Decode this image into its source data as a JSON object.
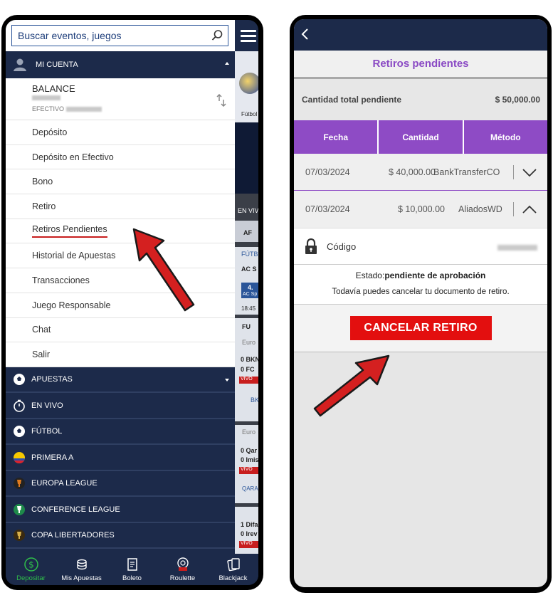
{
  "left": {
    "search": {
      "placeholder": "Buscar eventos, juegos"
    },
    "account_header": "MI CUENTA",
    "balance": {
      "label": "BALANCE",
      "cash_label": "EFECTIVO"
    },
    "menu_items": [
      "Depósito",
      "Depósito en Efectivo",
      "Bono",
      "Retiro",
      "Retiros Pendientes",
      "Historial de Apuestas",
      "Transacciones",
      "Juego Responsable",
      "Chat",
      "Salir"
    ],
    "nav_items": [
      {
        "label": "APUESTAS",
        "icon": "soccer-ball-icon"
      },
      {
        "label": "EN VIVO",
        "icon": "stopwatch-icon"
      },
      {
        "label": "FÚTBOL",
        "icon": "soccer-ball-icon"
      },
      {
        "label": "PRIMERA A",
        "icon": "colombia-flag-icon"
      },
      {
        "label": "EUROPA LEAGUE",
        "icon": "europa-league-icon"
      },
      {
        "label": "CONFERENCE LEAGUE",
        "icon": "conference-league-icon"
      },
      {
        "label": "COPA LIBERTADORES",
        "icon": "libertadores-icon"
      }
    ],
    "strip": {
      "t1": "Fútbol",
      "t2": "EN VIV",
      "t3": "AF",
      "t4": "FÚTB",
      "t5": "AC S",
      "t6": "4.",
      "t7": "AC Sp",
      "t8": "18:45",
      "t9": "FU",
      "t10": "Euro",
      "t11": "0 BKN",
      "t12": "0 FC",
      "t13": "VIVO",
      "t14": "BK",
      "t15": "Euro",
      "t16": "0 Qar",
      "t17": "0 Imis",
      "t18": "VIVO",
      "t19": "QARA",
      "t20": "1 Difa",
      "t21": "0 Irev",
      "t22": "VIVO"
    },
    "bottom_tabs": [
      {
        "label": "Depositar",
        "icon": "dollar-icon",
        "active": true
      },
      {
        "label": "Mis Apuestas",
        "icon": "coins-icon",
        "active": false
      },
      {
        "label": "Boleto",
        "icon": "ticket-icon",
        "active": false
      },
      {
        "label": "Roulette",
        "icon": "live-roulette-icon",
        "active": false
      },
      {
        "label": "Blackjack",
        "icon": "cards-icon",
        "active": false
      }
    ]
  },
  "right": {
    "title": "Retiros pendientes",
    "total_label": "Cantidad total pendiente",
    "total_value": "$ 50,000.00",
    "columns": [
      "Fecha",
      "Cantidad",
      "Método"
    ],
    "rows": [
      {
        "date": "07/03/2024",
        "amount": "$ 40,000.00",
        "method": "BankTransferCO",
        "expanded": false
      },
      {
        "date": "07/03/2024",
        "amount": "$ 10,000.00",
        "method": "AliadosWD",
        "expanded": true
      }
    ],
    "code_label": "Código",
    "status_prefix": "Estado:",
    "status_value": "pendiente de aprobación",
    "status_note": "Todavía puedes cancelar tu documento de retiro.",
    "cancel_label": "CANCELAR RETIRO"
  },
  "colors": {
    "navy": "#1c2a4a",
    "purple": "#8e4bc5",
    "red": "#e30f0f",
    "active_green": "#2fbf4a"
  }
}
